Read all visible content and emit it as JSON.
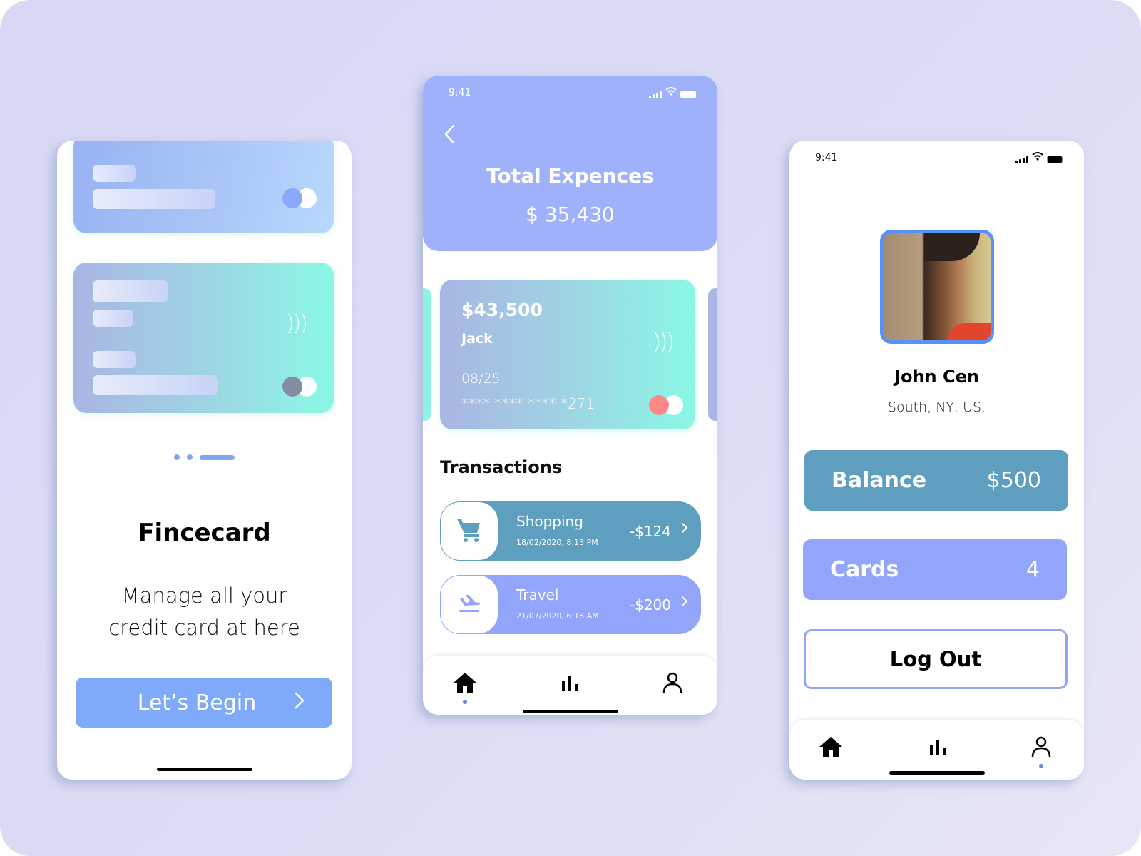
{
  "colors": {
    "accent_blue": "#7faaf9",
    "header_periwinkle": "#a0b1fc",
    "teal": "#5e9fbf",
    "lavender": "#93a5fa",
    "avatar_border": "#5693f8",
    "toggle_blue": "#8aa8fc",
    "toggle_gray": "#848da0",
    "toggle_red": "#fe8787"
  },
  "onboarding": {
    "cards": [
      {
        "toggle_color": "#8aa8fc",
        "contactless_icon": "contactless-icon"
      },
      {
        "toggle_color": "#848da0",
        "contactless_icon": "contactless-icon"
      }
    ],
    "pager": {
      "count": 3,
      "active_index": 2
    },
    "brand": "Fincecard",
    "tagline_line1": "Manage all your",
    "tagline_line2": "credit card at here",
    "cta_label": "Let’s Begin",
    "cta_icon": "chevron-right-icon"
  },
  "expenses": {
    "status_time": "9:41",
    "back_icon": "chevron-left-icon",
    "title": "Total Expences",
    "total": "$ 35,430",
    "card": {
      "amount": "$43,500",
      "holder": "Jack",
      "expiry": "08/25",
      "number": "**** **** **** *271",
      "toggle_color": "#fe8787"
    },
    "transactions_title": "Transactions",
    "transactions": [
      {
        "title": "Shopping",
        "date": "18/02/2020, 8:13 PM",
        "amount": "-$124",
        "icon": "shopping-cart-icon",
        "color": "#5e9fbf"
      },
      {
        "title": "Travel",
        "date": "21/07/2020, 6:18 AM",
        "amount": "-$200",
        "icon": "flight-landing-icon",
        "color": "#93a5fa"
      }
    ],
    "nav": {
      "items": [
        "home",
        "stats",
        "profile"
      ],
      "active": "home"
    }
  },
  "profile": {
    "status_time": "9:41",
    "name": "John Cen",
    "location": "South, NY, US.",
    "balance_label": "Balance",
    "balance_value": "$500",
    "cards_label": "Cards",
    "cards_value": "4",
    "logout_label": "Log Out",
    "nav": {
      "items": [
        "home",
        "stats",
        "profile"
      ],
      "active": "profile"
    }
  }
}
